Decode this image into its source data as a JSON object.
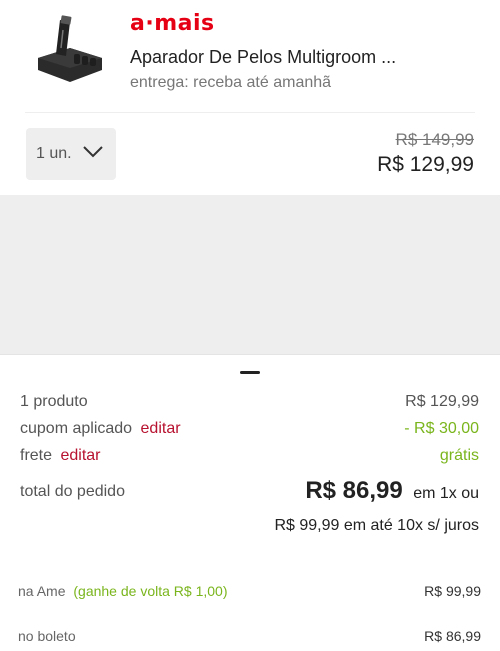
{
  "product": {
    "seller_logo": "a·mais",
    "title": "Aparador De Pelos Multigroom ...",
    "delivery": "entrega: receba até amanhã",
    "quantity": "1 un.",
    "old_price": "R$ 149,99",
    "price": "R$ 129,99"
  },
  "summary": {
    "products_label": "1 produto",
    "products_value": "R$ 129,99",
    "coupon_label": "cupom aplicado",
    "coupon_edit": "editar",
    "coupon_value": "- R$ 30,00",
    "shipping_label": "frete",
    "shipping_edit": "editar",
    "shipping_value": "grátis",
    "total_label": "total do pedido",
    "total_value": "R$ 86,99",
    "total_terms": "em 1x ou",
    "installments": "R$ 99,99 em até 10x s/ juros"
  },
  "payment": {
    "ame_label": "na Ame",
    "ame_cashback": "(ganhe de volta R$ 1,00)",
    "ame_value": "R$ 99,99",
    "boleto_label": "no boleto",
    "boleto_value": "R$ 86,99"
  },
  "colors": {
    "brand_red": "#e60014",
    "link_red": "#b7122f",
    "green": "#7ab51d"
  }
}
